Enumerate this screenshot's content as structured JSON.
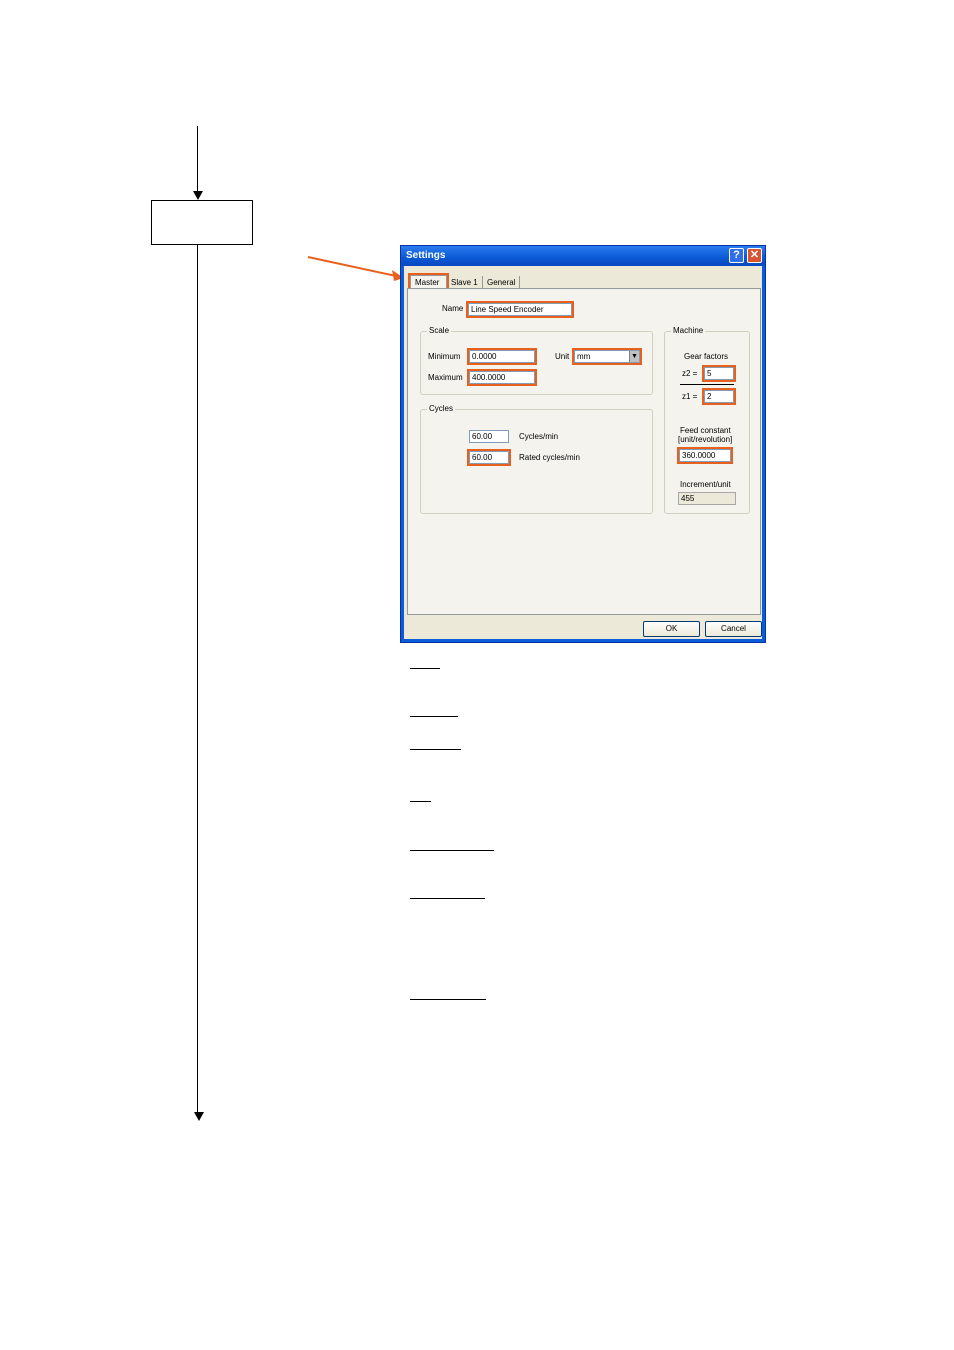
{
  "dialog": {
    "title": "Settings",
    "help_glyph": "?",
    "close_glyph": "✕",
    "tabs": [
      {
        "label": "Master",
        "active": true
      },
      {
        "label": "Slave 1",
        "active": false
      },
      {
        "label": "General",
        "active": false
      }
    ],
    "name_label": "Name",
    "name_value": "Line Speed Encoder",
    "scale": {
      "title": "Scale",
      "minimum_label": "Minimum",
      "minimum_value": "0.0000",
      "maximum_label": "Maximum",
      "maximum_value": "400.0000",
      "unit_label": "Unit",
      "unit_value": "mm"
    },
    "cycles": {
      "title": "Cycles",
      "cycles_value": "60.00",
      "cycles_label": "Cycles/min",
      "rated_value": "60.00",
      "rated_label": "Rated cycles/min"
    },
    "machine": {
      "title": "Machine",
      "gear_factors_label": "Gear factors",
      "z2_label": "z2 =",
      "z2_value": "5",
      "z1_label": "z1 =",
      "z1_value": "2",
      "feed_constant_label": "Feed constant",
      "feed_constant_unit": "[unit/revolution]",
      "feed_constant_value": "360.0000",
      "increment_label": "Increment/unit",
      "increment_value": "455"
    },
    "ok_label": "OK",
    "cancel_label": "Cancel"
  },
  "colors": {
    "highlight": "#e8601c",
    "titlebar": "#0a58d4",
    "dialog_bg": "#ece9d8"
  }
}
